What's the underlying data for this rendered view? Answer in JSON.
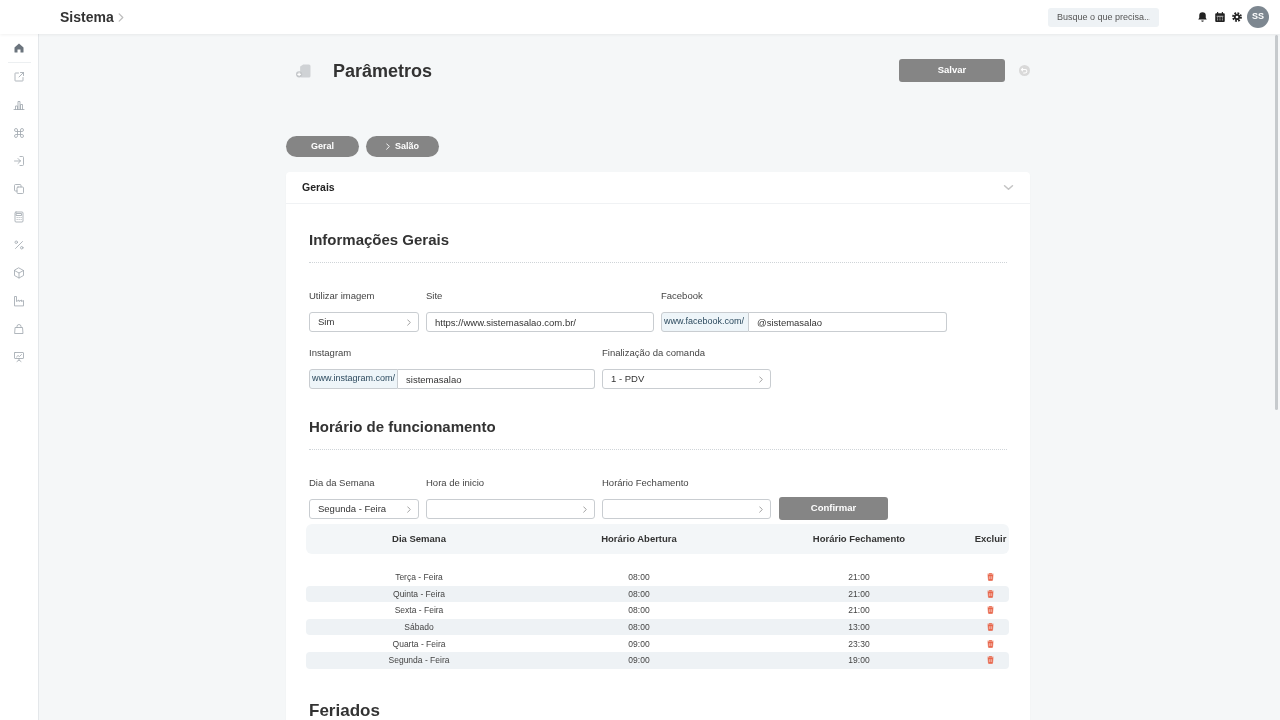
{
  "header": {
    "title": "Sistema",
    "search": {
      "placeholder": "Busque o que precisa..."
    },
    "avatar": "SS"
  },
  "sidebar": {
    "items": [
      {
        "selected": true
      },
      {
        "selected": false
      },
      {
        "selected": false
      },
      {
        "selected": false
      },
      {
        "selected": false
      },
      {
        "selected": false
      },
      {
        "selected": false
      },
      {
        "selected": false
      },
      {
        "selected": false
      },
      {
        "selected": false
      },
      {
        "selected": false
      },
      {
        "selected": false
      }
    ]
  },
  "page": {
    "title": "Parâmetros",
    "save_button": {
      "label": "Salvar",
      "disabled": true
    }
  },
  "tabs": [
    {
      "label": "Geral",
      "chevron": false
    },
    {
      "label": "Salão",
      "chevron": true
    }
  ],
  "section": {
    "title": "Gerais",
    "expanded": true
  },
  "general_info": {
    "title": "Informações Gerais",
    "fields": [
      {
        "kind": "select",
        "label": "Utilizar imagem",
        "value": "Sim"
      },
      {
        "kind": "text",
        "label": "Site",
        "value": "https://www.sistemasalao.com.br/"
      },
      {
        "kind": "prefixed",
        "label": "Facebook",
        "prefix": "www.facebook.com/",
        "value": "@sistemasalao"
      },
      {
        "kind": "prefixed",
        "label": "Instagram",
        "prefix": "www.instagram.com/",
        "value": "sistemasalao"
      },
      {
        "kind": "select",
        "label": "Finalização da comanda",
        "value": "1 - PDV"
      }
    ]
  },
  "opening_hours": {
    "title": "Horário de funcionamento",
    "fields": [
      {
        "kind": "select",
        "label": "Dia da Semana",
        "value": "Segunda - Feira"
      },
      {
        "kind": "select",
        "label": "Hora de inicio"
      },
      {
        "kind": "select",
        "label": "Horário Fechamento"
      }
    ],
    "confirm_button": {
      "label": "Confirmar",
      "disabled": true
    },
    "table": {
      "columns": [
        "Dia Semana",
        "Horário Abertura",
        "Horário Fechamento",
        "Excluir"
      ],
      "rows": [
        {
          "day": "Terça - Feira",
          "opening": "08:00",
          "closing": "21:00"
        },
        {
          "day": "Quinta - Feira",
          "opening": "08:00",
          "closing": "21:00"
        },
        {
          "day": "Sexta - Feira",
          "opening": "08:00",
          "closing": "21:00"
        },
        {
          "day": "Sábado",
          "opening": "08:00",
          "closing": "13:00"
        },
        {
          "day": "Quarta - Feira",
          "opening": "09:00",
          "closing": "23:30"
        },
        {
          "day": "Segunda - Feira",
          "opening": "09:00",
          "closing": "19:00"
        }
      ]
    }
  },
  "holidays": {
    "title": "Feriados"
  }
}
